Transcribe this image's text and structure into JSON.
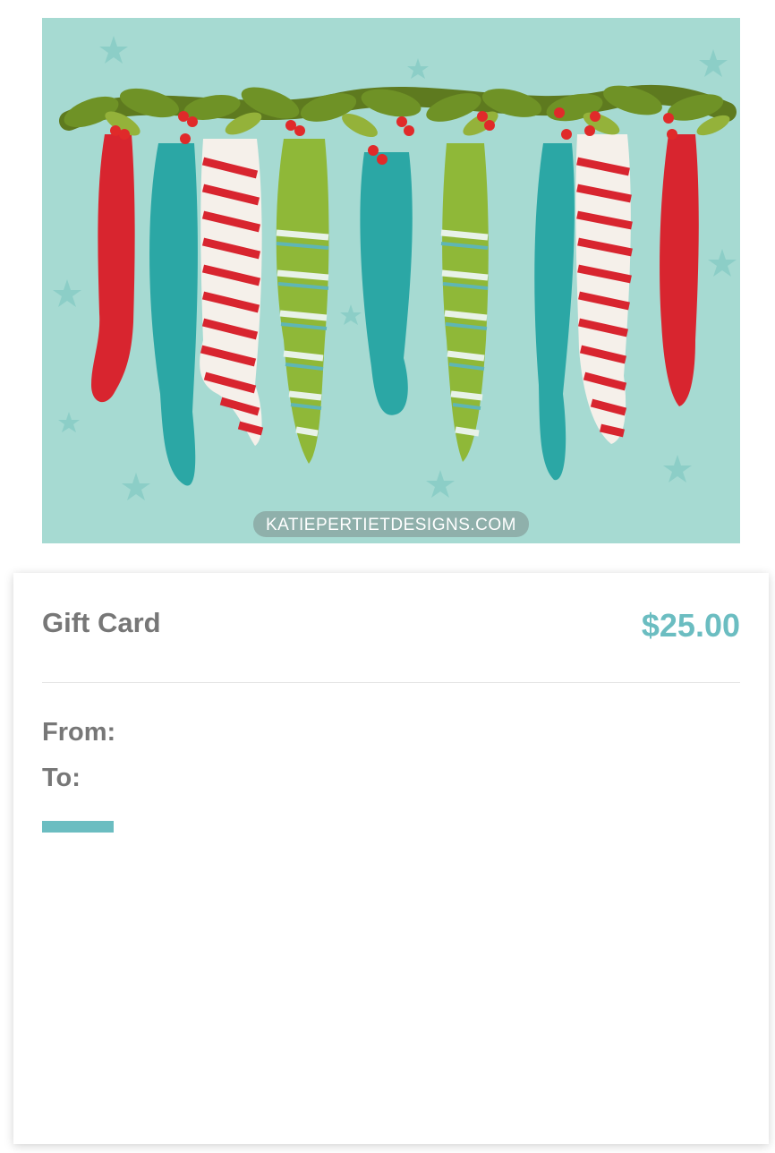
{
  "hero": {
    "image_name": "christmas-stockings-illustration",
    "watermark": "KATIEPERTIETDESIGNS.COM",
    "background_color": "#a6dad2"
  },
  "card": {
    "title": "Gift Card",
    "price": "$25.00",
    "from_label": "From:",
    "to_label": "To:"
  },
  "colors": {
    "accent": "#6bbdc1",
    "label_gray": "#777777"
  }
}
